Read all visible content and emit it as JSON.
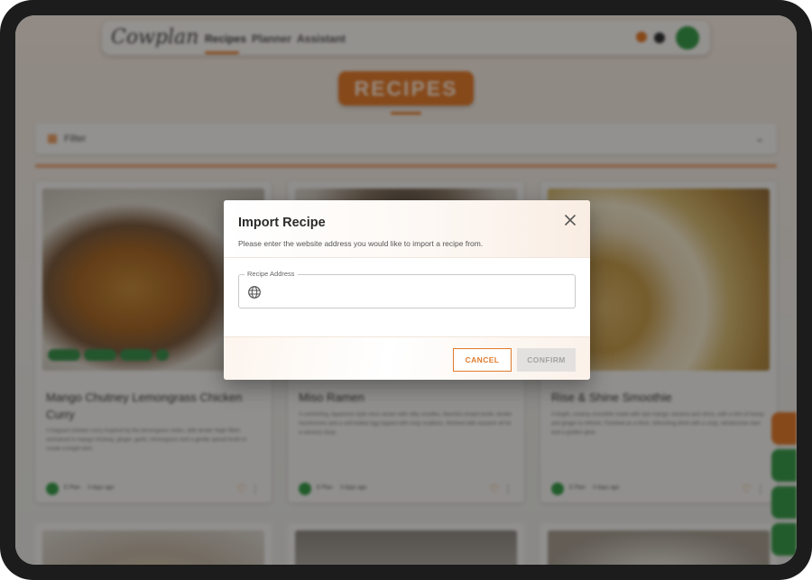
{
  "app": {
    "logo": "Cowplan",
    "nav": [
      "Recipes",
      "Planner",
      "Assistant"
    ],
    "page_title": "RECIPES",
    "filter_label": "Filter",
    "recipes": [
      {
        "title": "Mango Chutney Lemongrass Chicken Curry",
        "description": "A fragrant chicken curry inspired by the lemongrass notes, with tender thigh fillets simmered in mango chutney, ginger, garlic, lemongrass and a gentle spiced broth to create a bright dish.",
        "author": "E Plan",
        "time": "3 days ago"
      },
      {
        "title": "Miso Ramen",
        "description": "A comforting Japanese-style miso ramen with silky noodles, flavorful umami broth, tender mushrooms and a soft-boiled egg topped with crisp scallions, finished with sesame oil for a savoury slurp.",
        "author": "E Plan",
        "time": "3 days ago"
      },
      {
        "title": "Rise & Shine Smoothie",
        "description": "A bright, creamy smoothie made with ripe mango, banana and citrus, with a hint of honey and ginger to refresh. Finished as a thick, refreshing drink with a crisp, wholesome start and a golden glow.",
        "author": "E Plan",
        "time": "3 days ago"
      }
    ]
  },
  "dialog": {
    "title": "Import Recipe",
    "subtitle": "Please enter the website address you would like to import a recipe from.",
    "field_label": "Recipe Address",
    "field_value": "",
    "field_placeholder": "",
    "cancel_label": "CANCEL",
    "confirm_label": "CONFIRM",
    "close_icon": "close-icon",
    "field_icon": "globe-icon"
  },
  "colors": {
    "accent": "#e07a2c",
    "green": "#3a9a4a",
    "disabled_bg": "#e3e1df",
    "disabled_text": "#a3a3a3"
  }
}
